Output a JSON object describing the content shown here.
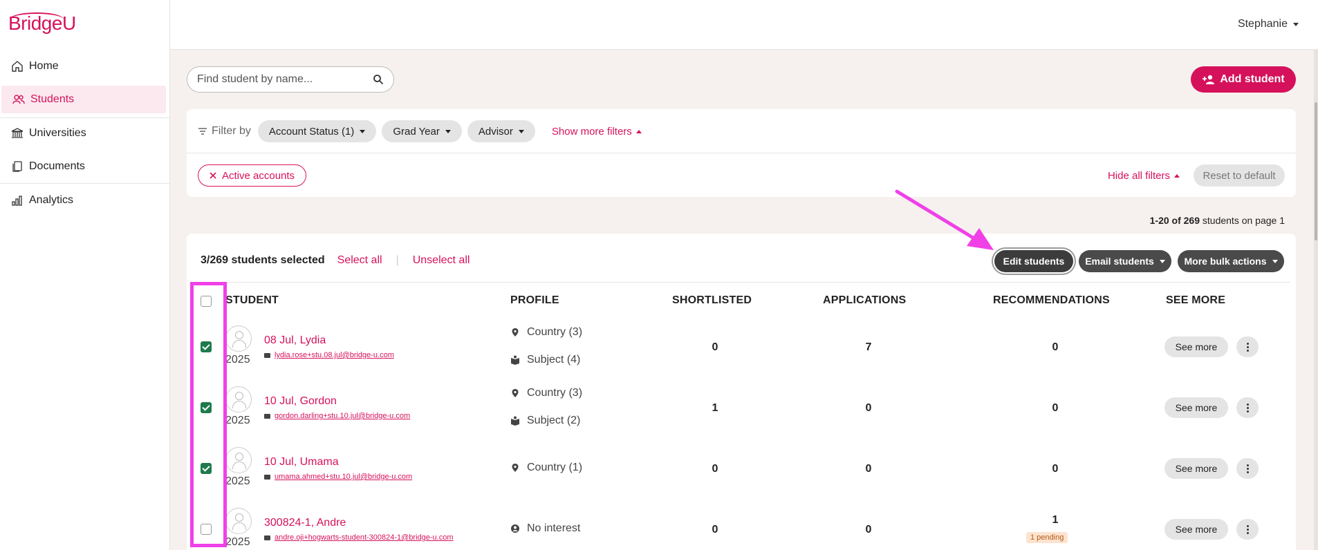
{
  "app": {
    "logo_text": "BridgeU",
    "user_name": "Stephanie"
  },
  "sidebar": {
    "items": [
      {
        "label": "Home",
        "icon": "home-icon"
      },
      {
        "label": "Students",
        "icon": "students-icon",
        "active": true
      },
      {
        "label": "Universities",
        "icon": "university-icon"
      },
      {
        "label": "Documents",
        "icon": "documents-icon"
      },
      {
        "label": "Analytics",
        "icon": "analytics-icon"
      }
    ]
  },
  "search": {
    "placeholder": "Find student by name..."
  },
  "add_student": {
    "label": "Add student"
  },
  "filters": {
    "filter_by_label": "Filter by",
    "chips": [
      "Account Status (1)",
      "Grad Year",
      "Advisor"
    ],
    "show_more_label": "Show more filters",
    "active_pill": "Active accounts",
    "hide_all_label": "Hide all filters",
    "reset_label": "Reset to default"
  },
  "pagination": {
    "range": "1-20 of 269",
    "suffix": " students on page 1"
  },
  "selection": {
    "count_label": "3/269 students selected",
    "select_all": "Select all",
    "separator": "|",
    "unselect_all": "Unselect all"
  },
  "bulk_actions": {
    "edit": "Edit students",
    "email": "Email students",
    "more": "More bulk actions"
  },
  "table": {
    "headers": [
      "STUDENT",
      "PROFILE",
      "SHORTLISTED",
      "APPLICATIONS",
      "RECOMMENDATIONS",
      "SEE MORE"
    ],
    "see_more_label": "See more",
    "rows": [
      {
        "name": "08 Jul, Lydia",
        "email": "lydia.rose+stu.08.jul@bridge-u.com",
        "year": "2025",
        "checked": true,
        "profile": [
          "Country (3)",
          "Subject (4)"
        ],
        "shortlisted": "0",
        "applications": "7",
        "recommendations": "0",
        "pending": ""
      },
      {
        "name": "10 Jul, Gordon",
        "email": "gordon.darling+stu.10.jul@bridge-u.com",
        "year": "2025",
        "checked": true,
        "profile": [
          "Country (3)",
          "Subject (2)"
        ],
        "shortlisted": "1",
        "applications": "0",
        "recommendations": "0",
        "pending": ""
      },
      {
        "name": "10 Jul, Umama",
        "email": "umama.ahmed+stu.10.jul@bridge-u.com",
        "year": "2025",
        "checked": true,
        "profile": [
          "Country (1)"
        ],
        "shortlisted": "0",
        "applications": "0",
        "recommendations": "0",
        "pending": ""
      },
      {
        "name": "300824-1, Andre",
        "email": "andre.oji+hogwarts-student-300824-1@bridge-u.com",
        "year": "2025",
        "checked": false,
        "profile": [
          "No interest"
        ],
        "shortlisted": "0",
        "applications": "0",
        "recommendations": "1",
        "pending": "1 pending"
      }
    ]
  },
  "colors": {
    "brand": "#d6115b",
    "annotation": "#f040e8",
    "check": "#1e7a4c"
  }
}
